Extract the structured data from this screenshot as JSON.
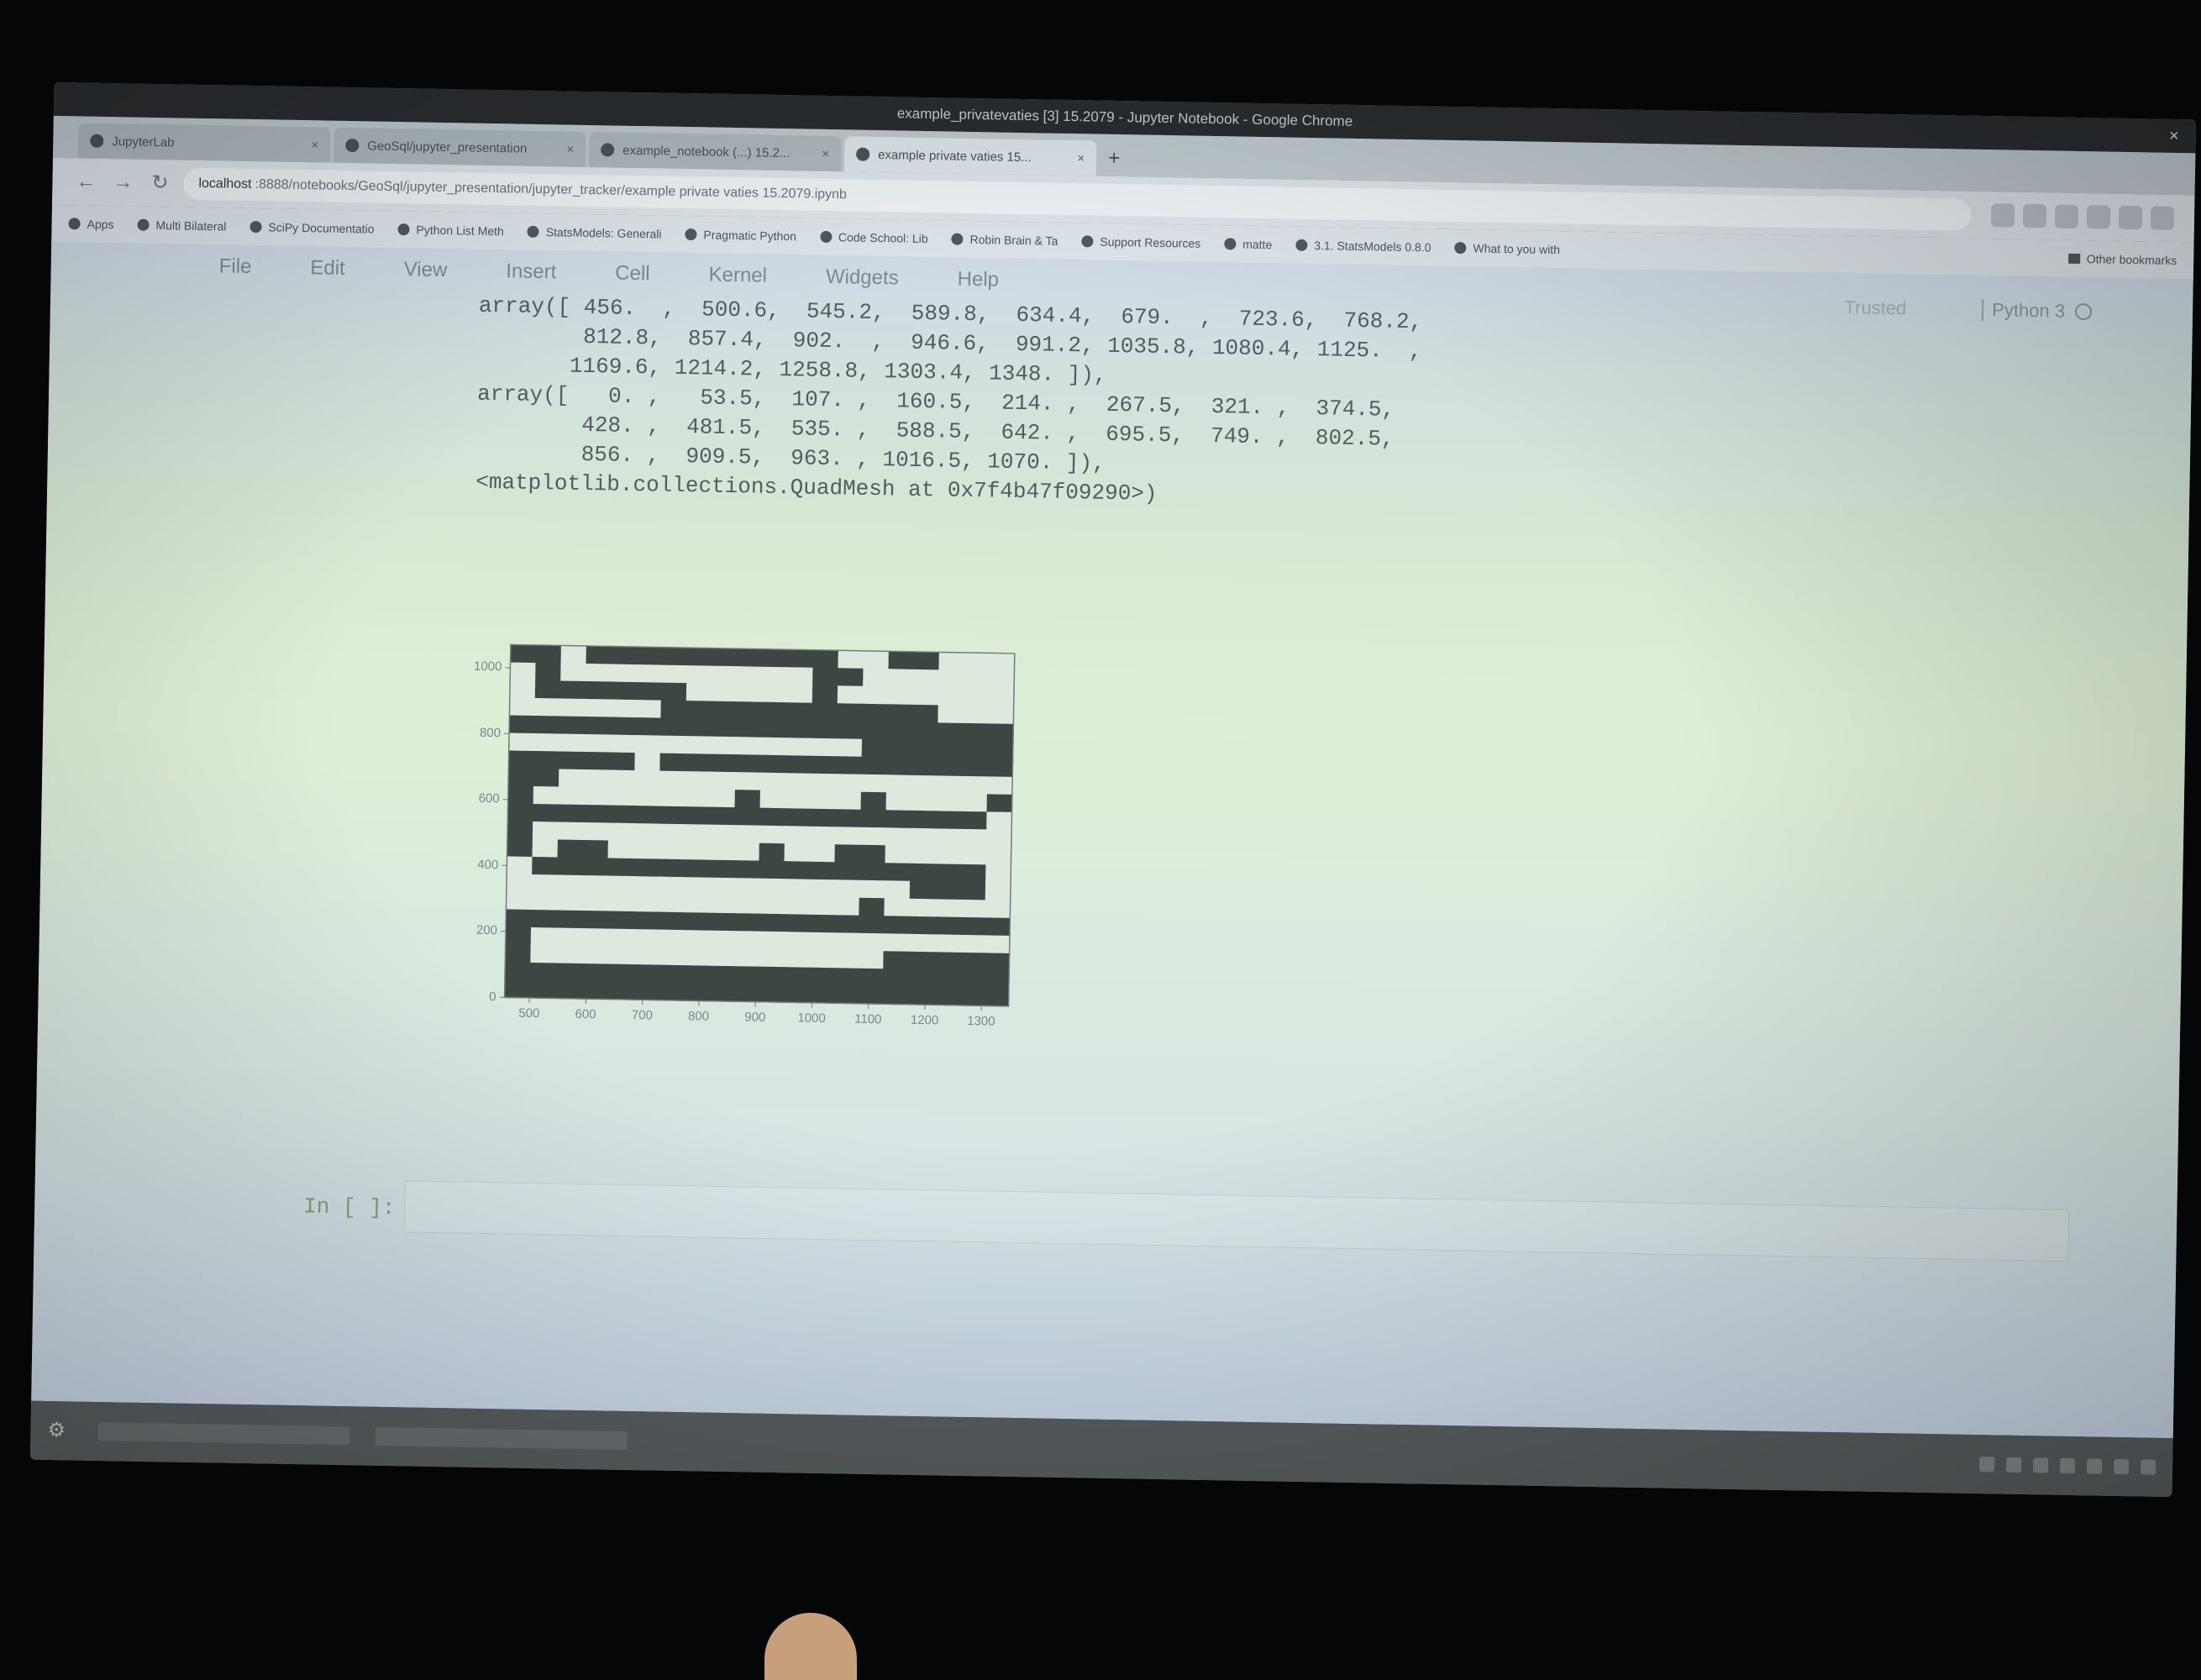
{
  "window": {
    "title": "example_privatevaties [3] 15.2079 - Jupyter Notebook - Google Chrome",
    "close_glyph": "×"
  },
  "tabs": [
    {
      "label": "JupyterLab",
      "active": false
    },
    {
      "label": "GeoSql/jupyter_presentation",
      "active": false
    },
    {
      "label": "example_notebook (...) 15.2...",
      "active": false
    },
    {
      "label": "example private vaties 15...",
      "active": true
    }
  ],
  "new_tab_glyph": "+",
  "address": {
    "host": "localhost",
    "path": ":8888/notebooks/GeoSql/jupyter_presentation/jupyter_tracker/example private vaties 15.2079.ipynb"
  },
  "bookmarks": [
    "Apps",
    "Multi Bilateral",
    "SciPy Documentatio",
    "Python List Meth",
    "StatsModels: Generali",
    "Pragmatic Python",
    "Code School: Lib",
    "Robin Brain & Ta",
    "Support Resources",
    "matte",
    "3.1. StatsModels 0.8.0",
    "What to you with"
  ],
  "bookmarks_other": "Other bookmarks",
  "menu": [
    "File",
    "Edit",
    "View",
    "Insert",
    "Cell",
    "Kernel",
    "Widgets",
    "Help"
  ],
  "kernel": {
    "trusted": "Trusted",
    "name": "Python 3"
  },
  "output_text": [
    "array([ 456.  ,  500.6,  545.2,  589.8,  634.4,  679.  ,  723.6,  768.2,",
    "        812.8,  857.4,  902.  ,  946.6,  991.2, 1035.8, 1080.4, 1125.  ,",
    "       1169.6, 1214.2, 1258.8, 1303.4, 1348. ]),",
    "array([   0. ,   53.5,  107. ,  160.5,  214. ,  267.5,  321. ,  374.5,",
    "        428. ,  481.5,  535. ,  588.5,  642. ,  695.5,  749. ,  802.5,",
    "        856. ,  909.5,  963. , 1016.5, 1070. ]),",
    "<matplotlib.collections.QuadMesh at 0x7f4b47f09290>)"
  ],
  "chart_data": {
    "type": "heatmap",
    "x_edges": [
      456,
      500.6,
      545.2,
      589.8,
      634.4,
      679,
      723.6,
      768.2,
      812.8,
      857.4,
      902,
      946.6,
      991.2,
      1035.8,
      1080.4,
      1125,
      1169.6,
      1214.2,
      1258.8,
      1303.4,
      1348
    ],
    "y_edges": [
      0,
      53.5,
      107,
      160.5,
      214,
      267.5,
      321,
      374.5,
      428,
      481.5,
      535,
      588.5,
      642,
      695.5,
      749,
      802.5,
      856,
      909.5,
      963,
      1016.5,
      1070
    ],
    "xticks": [
      "500",
      "600",
      "700",
      "800",
      "900",
      "1000",
      "1100",
      "1200",
      "1300"
    ],
    "yticks": [
      "0",
      "200",
      "400",
      "600",
      "800",
      "1000"
    ],
    "xlim": [
      456,
      1348
    ],
    "ylim": [
      0,
      1070
    ],
    "grid": false,
    "cells": [
      [
        1,
        1,
        0,
        1,
        1,
        1,
        1,
        1,
        1,
        1,
        1,
        1,
        1,
        0,
        0,
        1,
        1,
        0,
        0,
        0
      ],
      [
        0,
        1,
        0,
        0,
        0,
        0,
        0,
        0,
        0,
        0,
        0,
        0,
        1,
        1,
        0,
        0,
        0,
        0,
        0,
        0
      ],
      [
        0,
        1,
        1,
        1,
        1,
        1,
        1,
        0,
        0,
        0,
        0,
        0,
        1,
        0,
        0,
        0,
        0,
        0,
        0,
        0
      ],
      [
        0,
        0,
        0,
        0,
        0,
        0,
        1,
        1,
        1,
        1,
        1,
        1,
        1,
        1,
        1,
        1,
        1,
        0,
        0,
        0
      ],
      [
        1,
        1,
        1,
        1,
        1,
        1,
        1,
        1,
        1,
        1,
        1,
        1,
        1,
        1,
        1,
        1,
        1,
        1,
        1,
        1
      ],
      [
        0,
        0,
        0,
        0,
        0,
        0,
        0,
        0,
        0,
        0,
        0,
        0,
        0,
        0,
        1,
        1,
        1,
        1,
        1,
        1
      ],
      [
        1,
        1,
        1,
        1,
        1,
        0,
        1,
        1,
        1,
        1,
        1,
        1,
        1,
        1,
        1,
        1,
        1,
        1,
        1,
        1
      ],
      [
        1,
        1,
        0,
        0,
        0,
        0,
        0,
        0,
        0,
        0,
        0,
        0,
        0,
        0,
        0,
        0,
        0,
        0,
        0,
        0
      ],
      [
        1,
        0,
        0,
        0,
        0,
        0,
        0,
        0,
        0,
        1,
        0,
        0,
        0,
        0,
        1,
        0,
        0,
        0,
        0,
        1
      ],
      [
        1,
        1,
        1,
        1,
        1,
        1,
        1,
        1,
        1,
        1,
        1,
        1,
        1,
        1,
        1,
        1,
        1,
        1,
        1,
        0
      ],
      [
        1,
        0,
        0,
        0,
        0,
        0,
        0,
        0,
        0,
        0,
        0,
        0,
        0,
        0,
        0,
        0,
        0,
        0,
        0,
        0
      ],
      [
        1,
        0,
        1,
        1,
        0,
        0,
        0,
        0,
        0,
        0,
        1,
        0,
        0,
        1,
        1,
        0,
        0,
        0,
        0,
        0
      ],
      [
        0,
        1,
        1,
        1,
        1,
        1,
        1,
        1,
        1,
        1,
        1,
        1,
        1,
        1,
        1,
        1,
        1,
        1,
        1,
        0
      ],
      [
        0,
        0,
        0,
        0,
        0,
        0,
        0,
        0,
        0,
        0,
        0,
        0,
        0,
        0,
        0,
        0,
        1,
        1,
        1,
        0
      ],
      [
        0,
        0,
        0,
        0,
        0,
        0,
        0,
        0,
        0,
        0,
        0,
        0,
        0,
        0,
        1,
        0,
        0,
        0,
        0,
        0
      ],
      [
        1,
        1,
        1,
        1,
        1,
        1,
        1,
        1,
        1,
        1,
        1,
        1,
        1,
        1,
        1,
        1,
        1,
        1,
        1,
        1
      ],
      [
        1,
        0,
        0,
        0,
        0,
        0,
        0,
        0,
        0,
        0,
        0,
        0,
        0,
        0,
        0,
        0,
        0,
        0,
        0,
        0
      ],
      [
        1,
        0,
        0,
        0,
        0,
        0,
        0,
        0,
        0,
        0,
        0,
        0,
        0,
        0,
        0,
        1,
        1,
        1,
        1,
        1
      ],
      [
        1,
        1,
        1,
        1,
        1,
        1,
        1,
        1,
        1,
        1,
        1,
        1,
        1,
        1,
        1,
        1,
        1,
        1,
        1,
        1
      ],
      [
        1,
        1,
        1,
        1,
        1,
        1,
        1,
        1,
        1,
        1,
        1,
        1,
        1,
        1,
        1,
        1,
        1,
        1,
        1,
        1
      ]
    ]
  },
  "cell_prompt": "In [ ]:",
  "colors": {
    "dark_cell": "#3d4643",
    "light_cell": "#dfe8dc"
  }
}
